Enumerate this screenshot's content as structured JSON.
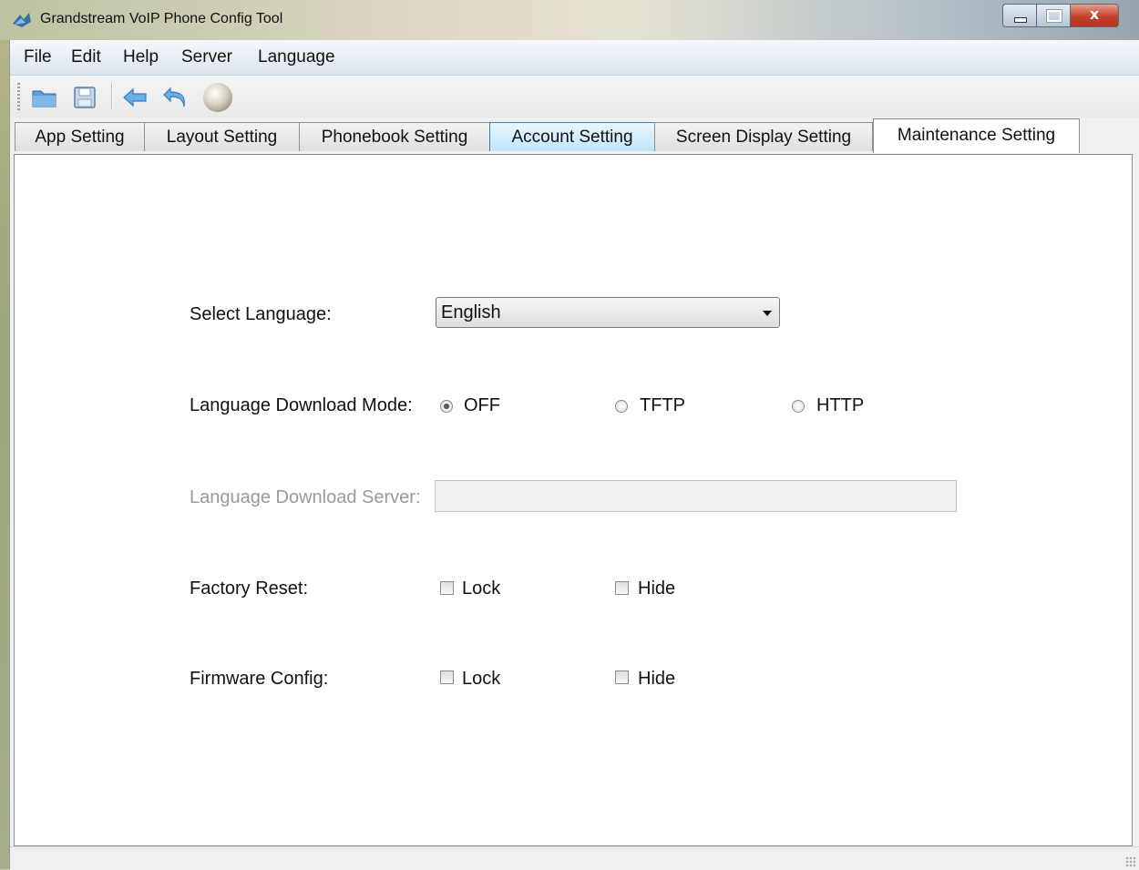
{
  "window": {
    "title": "Grandstream VoIP Phone Config Tool"
  },
  "menu": {
    "items": [
      "File",
      "Edit",
      "Help",
      "Server",
      "Language"
    ]
  },
  "toolbar": {
    "icons": [
      "open-folder-icon",
      "save-icon",
      "back-arrow-icon",
      "undo-icon",
      "globe-icon"
    ]
  },
  "tabs": [
    {
      "label": "App Setting"
    },
    {
      "label": "Layout Setting"
    },
    {
      "label": "Phonebook Setting"
    },
    {
      "label": "Account Setting"
    },
    {
      "label": "Screen Display Setting"
    },
    {
      "label": "Maintenance Setting"
    }
  ],
  "active_tab": "Maintenance Setting",
  "form": {
    "select_language": {
      "label": "Select Language:",
      "value": "English"
    },
    "download_mode": {
      "label": "Language Download Mode:",
      "options": [
        "OFF",
        "TFTP",
        "HTTP"
      ],
      "selected": "OFF"
    },
    "download_server": {
      "label": "Language Download Server:",
      "value": ""
    },
    "factory_reset": {
      "label": "Factory Reset:",
      "lock": "Lock",
      "hide": "Hide"
    },
    "firmware_config": {
      "label": "Firmware Config:",
      "lock": "Lock",
      "hide": "Hide"
    }
  }
}
